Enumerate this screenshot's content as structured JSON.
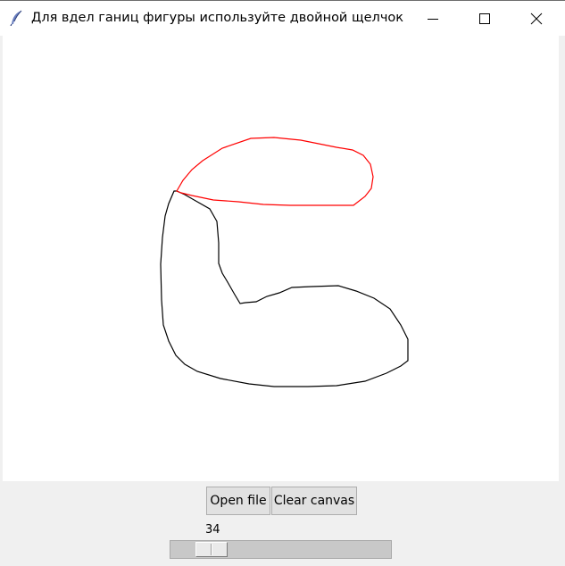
{
  "window": {
    "title": "Для вдел ганиц фигуры используйте двойной щелчок",
    "icon": "feather-icon",
    "controls": [
      "minimize-icon",
      "maximize-icon",
      "close-icon"
    ]
  },
  "canvas": {
    "background": "#ffffff",
    "shapes": [
      {
        "name": "outline-black",
        "color": "#000000"
      },
      {
        "name": "outline-red",
        "color": "#ff0000"
      }
    ]
  },
  "buttons": {
    "open_file": "Open file",
    "clear_canvas": "Clear canvas"
  },
  "scale": {
    "value": "34",
    "min": 0,
    "max": 255,
    "position": 0.134
  }
}
